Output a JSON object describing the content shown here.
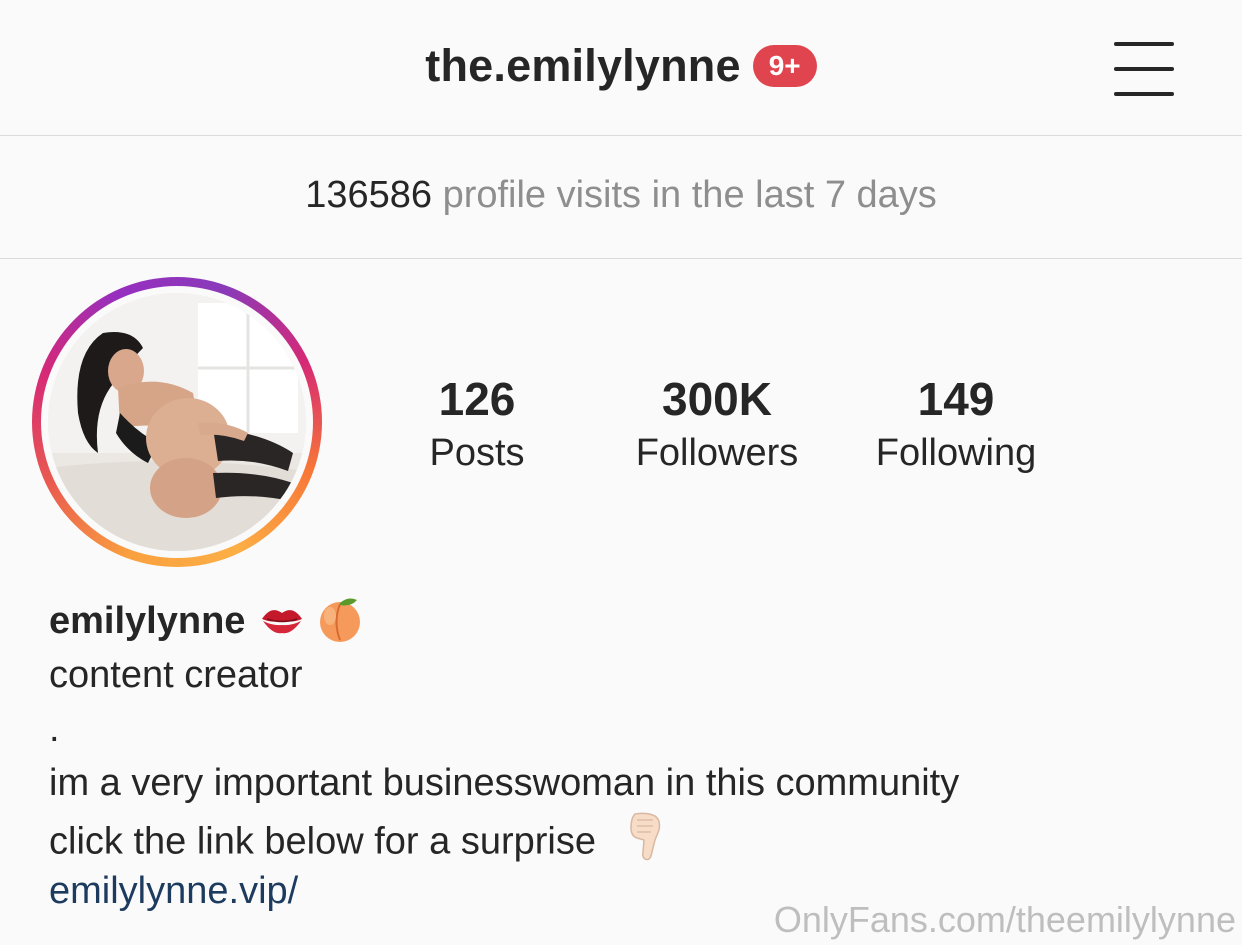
{
  "header": {
    "username": "the.emilylynne",
    "notification_badge": "9+",
    "menu_icon": "hamburger-menu-icon"
  },
  "insights": {
    "visits_count": "136586",
    "visits_label": "profile visits in the last 7 days"
  },
  "profile": {
    "avatar_icon": "profile-photo",
    "stats": [
      {
        "value": "126",
        "label": "Posts"
      },
      {
        "value": "300K",
        "label": "Followers"
      },
      {
        "value": "149",
        "label": "Following"
      }
    ],
    "display_name": "emilylynne",
    "name_emojis": [
      "kiss-mark-icon",
      "peach-icon"
    ],
    "bio_lines": [
      "content creator",
      ".",
      "im a very important businesswoman in this community",
      "click the link below for a surprise"
    ],
    "bio_emoji": "pointing-down-icon",
    "link": "emilylynne.vip/"
  },
  "watermark": "OnlyFans.com/theemilylynne",
  "colors": {
    "badge": "#e0454f",
    "link": "#1d3a5f",
    "secondary_text": "#8e8e8e",
    "background": "#fafafa"
  }
}
